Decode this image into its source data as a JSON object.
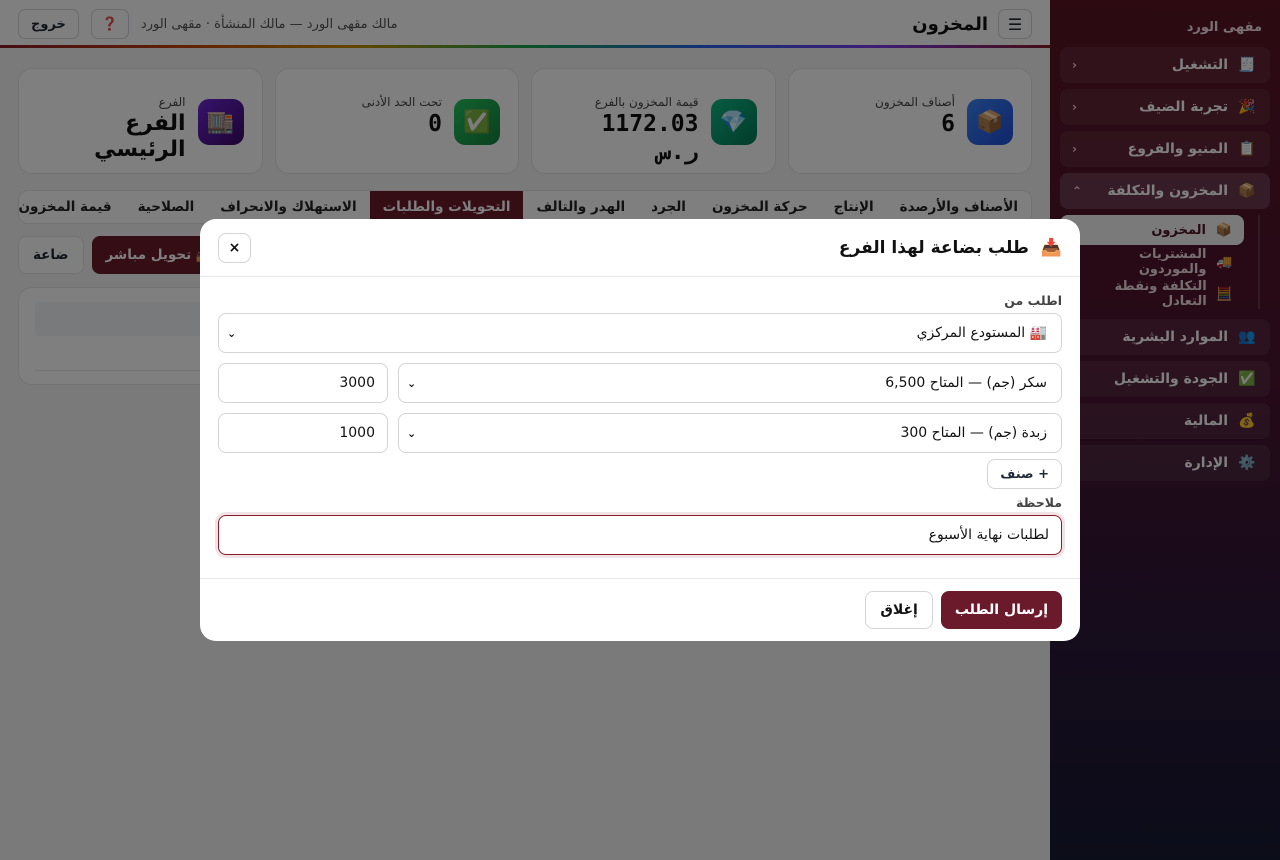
{
  "sidebar": {
    "brand": "مقهى الورد",
    "items": [
      {
        "icon": "🧾",
        "icon_name": "receipt-icon",
        "label": "التشغيل",
        "chevron": "‹"
      },
      {
        "icon": "🎉",
        "icon_name": "party-icon",
        "label": "تجربة الضيف",
        "chevron": "‹"
      },
      {
        "icon": "📋",
        "icon_name": "clipboard-icon",
        "label": "المنيو والفروع",
        "chevron": "‹"
      },
      {
        "icon": "📦",
        "icon_name": "package-icon",
        "label": "المخزون والتكلفة",
        "chevron": "⌃"
      },
      {
        "icon": "👥",
        "icon_name": "people-icon",
        "label": "الموارد البشرية"
      },
      {
        "icon": "✅",
        "icon_name": "check-icon",
        "label": "الجودة والتشغيل"
      },
      {
        "icon": "💰",
        "icon_name": "money-bag-icon",
        "label": "المالية"
      },
      {
        "icon": "⚙️",
        "icon_name": "gear-icon",
        "label": "الإدارة"
      }
    ],
    "subitems": [
      {
        "icon": "📦",
        "icon_name": "package-icon",
        "label": "المخزون"
      },
      {
        "icon": "🚚",
        "icon_name": "truck-icon",
        "label": "المشتريات والموردون"
      },
      {
        "icon": "🧮",
        "icon_name": "abacus-icon",
        "label": "التكلفة ونقطة التعادل"
      }
    ]
  },
  "topbar": {
    "menu_icon": "☰",
    "title": "المخزون",
    "meta": "مالك مقهى الورد — مالك المنشأة · مقهى الورد",
    "help_icon": "❓",
    "logout": "خروج"
  },
  "stats": [
    {
      "icon": "📦",
      "icon_name": "package-icon",
      "color": "#2563eb",
      "label": "أصناف المخزون",
      "value": "6"
    },
    {
      "icon": "💎",
      "icon_name": "gem-icon",
      "color": "#059669",
      "label": "قيمة المخزون بالفرع",
      "value": "1172.03",
      "unit": "ر.س"
    },
    {
      "icon": "✅",
      "icon_name": "check-icon",
      "color": "#15803d",
      "label": "تحت الحد الأدنى",
      "value": "0"
    },
    {
      "icon": "🏬",
      "icon_name": "building-icon",
      "color": "#4c1d95",
      "label": "الفرع",
      "value": "الفرع الرئيسي"
    }
  ],
  "tabs": [
    "الأصناف والأرصدة",
    "الإنتاج",
    "حركة المخزون",
    "الجرد",
    "الهدر والتالف",
    "التحويلات والطلبات",
    "الاستهلاك والانحراف",
    "الصلاحية",
    "قيمة المخزون"
  ],
  "active_tab": "التحويلات والطلبات",
  "actions": {
    "direct_transfer": "📤 تحويل مباشر",
    "request_partial": "ضاعة"
  },
  "modal": {
    "title_icon": "📥",
    "title": "طلب بضاعة لهذا الفرع",
    "close": "×",
    "from_label": "اطلب من",
    "from_value": "🏭 المستودع المركزي",
    "items": [
      {
        "item": "سكر (جم) — المتاح 6,500",
        "qty": "3000"
      },
      {
        "item": "زبدة (جم) — المتاح 300",
        "qty": "1000"
      }
    ],
    "add_item": "+ صنف",
    "note_label": "ملاحظة",
    "note_value": "لطلبات نهاية الأسبوع",
    "submit": "إرسال الطلب",
    "cancel": "إغلاق"
  },
  "colors": {
    "brand": "#6b1a2b",
    "sidebar_top": "#5a1424",
    "sidebar_bottom": "#171a33"
  }
}
